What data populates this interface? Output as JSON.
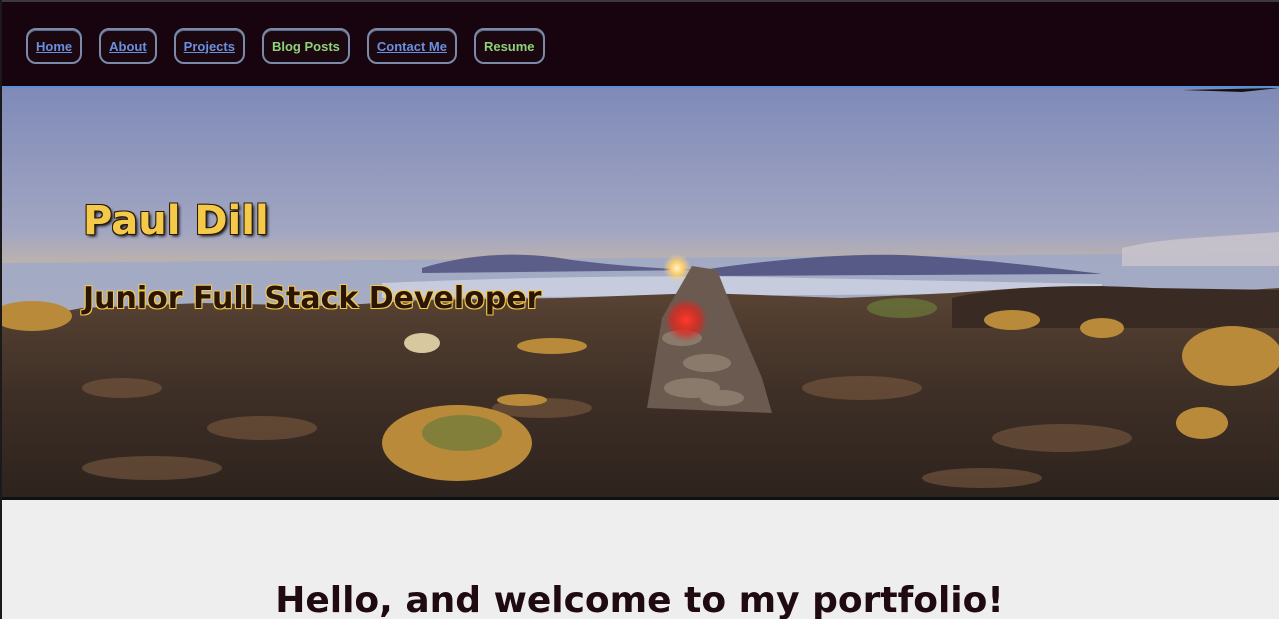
{
  "nav": {
    "items": [
      {
        "label": "Home",
        "style": "blue"
      },
      {
        "label": "About",
        "style": "blue"
      },
      {
        "label": "Projects",
        "style": "blue"
      },
      {
        "label": "Blog Posts",
        "style": "green"
      },
      {
        "label": "Contact Me",
        "style": "blue"
      },
      {
        "label": "Resume",
        "style": "green"
      }
    ]
  },
  "hero": {
    "title": "Paul Dill",
    "subtitle": "Junior Full Stack Developer"
  },
  "main": {
    "welcome": "Hello, and welcome to my portfolio!"
  },
  "colors": {
    "topbar": "#17040e",
    "accent_border": "#5b8fd6",
    "link_blue": "#6a90e0",
    "link_green": "#8fd17a",
    "title_gold": "#f5c94a"
  }
}
